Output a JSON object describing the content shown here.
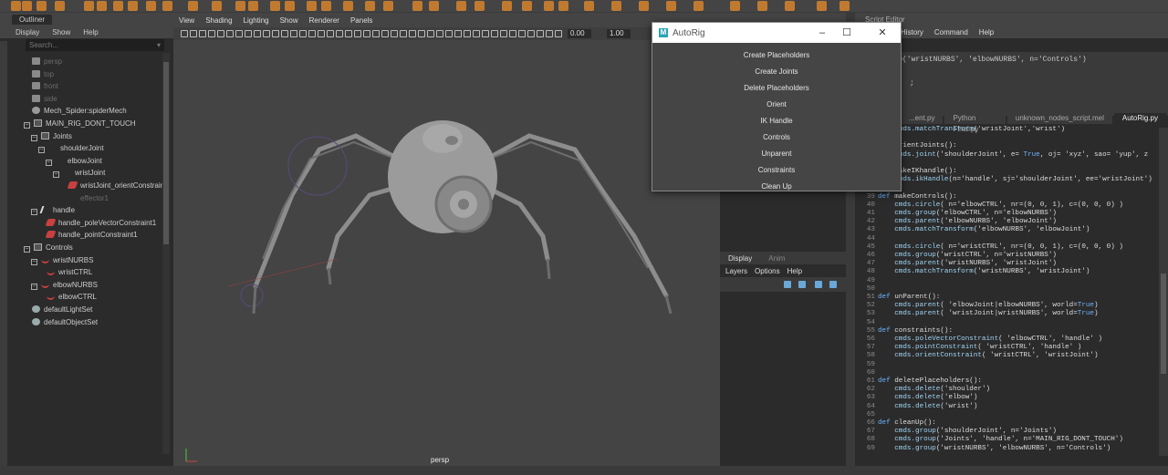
{
  "outliner": {
    "tab": "Outliner",
    "menu": [
      "Display",
      "Show",
      "Help"
    ],
    "search_placeholder": "Search...",
    "items": [
      {
        "label": "persp",
        "dim": true
      },
      {
        "label": "top",
        "dim": true
      },
      {
        "label": "front",
        "dim": true
      },
      {
        "label": "side",
        "dim": true
      },
      {
        "label": "Mech_Spider:spiderMech",
        "dim": false
      },
      {
        "label": "MAIN_RIG_DONT_TOUCH",
        "dim": false
      },
      {
        "label": "Joints",
        "dim": false
      },
      {
        "label": "shoulderJoint",
        "dim": false
      },
      {
        "label": "elbowJoint",
        "dim": false
      },
      {
        "label": "wristJoint",
        "dim": false
      },
      {
        "label": "wristJoint_orientConstraint",
        "dim": false
      },
      {
        "label": "effector1",
        "dim": true
      },
      {
        "label": "handle",
        "dim": false
      },
      {
        "label": "handle_poleVectorConstraint1",
        "dim": false
      },
      {
        "label": "handle_pointConstraint1",
        "dim": false
      },
      {
        "label": "Controls",
        "dim": false
      },
      {
        "label": "wristNURBS",
        "dim": false
      },
      {
        "label": "wristCTRL",
        "dim": false
      },
      {
        "label": "elbowNURBS",
        "dim": false
      },
      {
        "label": "elbowCTRL",
        "dim": false
      },
      {
        "label": "defaultLightSet",
        "dim": false
      },
      {
        "label": "defaultObjectSet",
        "dim": false
      }
    ]
  },
  "viewport": {
    "menu": [
      "View",
      "Shading",
      "Lighting",
      "Show",
      "Renderer",
      "Panels"
    ],
    "field1": "0.00",
    "field2": "1.00",
    "camera_label": "persp"
  },
  "autorig": {
    "title": "AutoRig",
    "buttons": [
      "Create Placeholders",
      "Create Joints",
      "Delete Placeholders",
      "Orient",
      "IK Handle",
      "Controls",
      "Unparent",
      "Constraints",
      "Clean Up"
    ]
  },
  "display_panel": {
    "tabs": [
      "Display",
      "Anim"
    ],
    "menu": [
      "Layers",
      "Options",
      "Help"
    ]
  },
  "script_editor": {
    "title": "Script Editor",
    "menu": [
      "History",
      "Command",
      "Help"
    ],
    "history": [
      "group('wristNURBS', 'elbowNURBS', n='Controls')",
      "",
      ";"
    ],
    "tabs": [
      "...ent.py",
      "Python Final.py",
      "unknown_nodes_script.mel",
      "AutoRig.py"
    ],
    "active_tab": "AutoRig.py",
    "code": [
      {
        "n": "",
        "t": "    cmds.matchTransform('wristJoint','wrist')"
      },
      {
        "n": "",
        "t": ""
      },
      {
        "n": "",
        "t": "def orientJoints():"
      },
      {
        "n": "",
        "t": "    cmds.joint('shoulderJoint', e= True, oj= 'xyz', sao= 'yup', z"
      },
      {
        "n": "",
        "t": ""
      },
      {
        "n": "",
        "t": "def makeIKhandle():"
      },
      {
        "n": "",
        "t": "    cmds.ikHandle(n='handle', sj='shoulderJoint', ee='wristJoint')"
      },
      {
        "n": "",
        "t": ""
      },
      {
        "n": "39",
        "t": "def makeControls():"
      },
      {
        "n": "40",
        "t": "    cmds.circle( n='elbowCTRL', nr=(0, 0, 1), c=(0, 0, 0) )"
      },
      {
        "n": "41",
        "t": "    cmds.group('elbowCTRL', n='elbowNURBS')"
      },
      {
        "n": "42",
        "t": "    cmds.parent('elbowNURBS', 'elbowJoint')"
      },
      {
        "n": "43",
        "t": "    cmds.matchTransform('elbowNURBS', 'elbowJoint')"
      },
      {
        "n": "44",
        "t": ""
      },
      {
        "n": "45",
        "t": "    cmds.circle( n='wristCTRL', nr=(0, 0, 1), c=(0, 0, 0) )"
      },
      {
        "n": "46",
        "t": "    cmds.group('wristCTRL', n='wristNURBS')"
      },
      {
        "n": "47",
        "t": "    cmds.parent('wristNURBS', 'wristJoint')"
      },
      {
        "n": "48",
        "t": "    cmds.matchTransform('wristNURBS', 'wristJoint')"
      },
      {
        "n": "49",
        "t": ""
      },
      {
        "n": "50",
        "t": ""
      },
      {
        "n": "51",
        "t": "def unParent():"
      },
      {
        "n": "52",
        "t": "    cmds.parent( 'elbowJoint|elbowNURBS', world=True)"
      },
      {
        "n": "53",
        "t": "    cmds.parent( 'wristJoint|wristNURBS', world=True)"
      },
      {
        "n": "54",
        "t": ""
      },
      {
        "n": "55",
        "t": "def constraints():"
      },
      {
        "n": "56",
        "t": "    cmds.poleVectorConstraint( 'elbowCTRL', 'handle' )"
      },
      {
        "n": "57",
        "t": "    cmds.pointConstraint( 'wristCTRL', 'handle' )"
      },
      {
        "n": "58",
        "t": "    cmds.orientConstraint( 'wristCTRL', 'wristJoint')"
      },
      {
        "n": "59",
        "t": ""
      },
      {
        "n": "60",
        "t": ""
      },
      {
        "n": "61",
        "t": "def deletePlaceholders():"
      },
      {
        "n": "62",
        "t": "    cmds.delete('shoulder')"
      },
      {
        "n": "63",
        "t": "    cmds.delete('elbow')"
      },
      {
        "n": "64",
        "t": "    cmds.delete('wrist')"
      },
      {
        "n": "65",
        "t": ""
      },
      {
        "n": "66",
        "t": "def cleanUp():"
      },
      {
        "n": "67",
        "t": "    cmds.group('shoulderJoint', n='Joints')"
      },
      {
        "n": "68",
        "t": "    cmds.group('Joints', 'handle', n='MAIN_RIG_DONT_TOUCH')"
      },
      {
        "n": "69",
        "t": "    cmds.group('wristNURBS', 'elbowNURBS', n='Controls')"
      }
    ]
  },
  "colors": {
    "accent": "#2aa3b7",
    "toolbar_icon": "#c07a30",
    "keyword": "#6cb2ff",
    "call": "#9fd4f3"
  }
}
